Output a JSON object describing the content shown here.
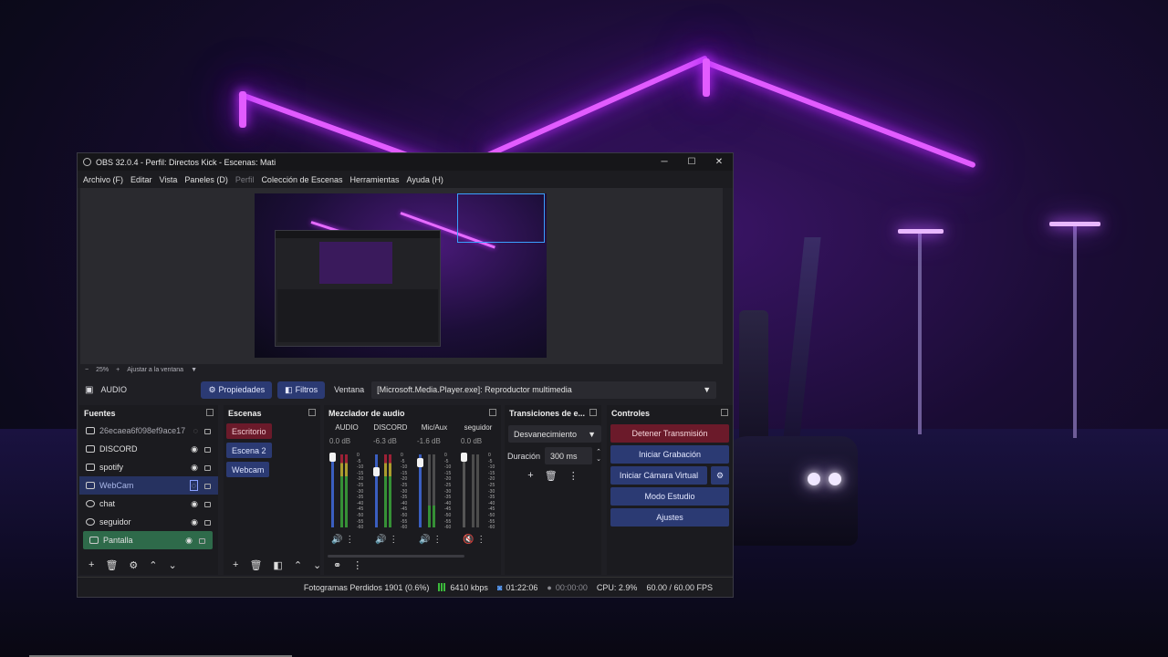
{
  "window": {
    "title": "OBS 32.0.4 - Perfil: Directos Kick - Escenas: Mati"
  },
  "menu": [
    "Archivo (F)",
    "Editar",
    "Vista",
    "Paneles (D)",
    "Perfil",
    "Colección de Escenas",
    "Herramientas",
    "Ayuda (H)"
  ],
  "zoom": {
    "level": "25%",
    "fit_label": "Ajustar a la ventana"
  },
  "source_bar": {
    "selected": "AUDIO",
    "properties": "Propiedades",
    "filters": "Filtros",
    "window_label": "Ventana",
    "window_value": "[Microsoft.Media.Player.exe]: Reproductor multimedia"
  },
  "sources": {
    "title": "Fuentes",
    "items": [
      {
        "name": "26ecaea6f098ef9ace17",
        "visible": false
      },
      {
        "name": "DISCORD",
        "visible": true
      },
      {
        "name": "spotify",
        "visible": true
      },
      {
        "name": "WebCam",
        "visible": false
      },
      {
        "name": "chat",
        "visible": true
      },
      {
        "name": "seguidor",
        "visible": true
      },
      {
        "name": "Pantalla",
        "visible": true
      }
    ]
  },
  "scenes": {
    "title": "Escenas",
    "items": [
      "Escritorio",
      "Escena 2",
      "Webcam"
    ]
  },
  "mixer": {
    "title": "Mezclador de audio",
    "channels": [
      {
        "name": "AUDIO",
        "db": "0.0 dB",
        "muted": false
      },
      {
        "name": "DISCORD",
        "db": "-6.3 dB",
        "muted": false
      },
      {
        "name": "Mic/Aux",
        "db": "-1.6 dB",
        "muted": false
      },
      {
        "name": "seguidor",
        "db": "0.0 dB",
        "muted": true
      }
    ],
    "ticks": [
      "0",
      "-5",
      "-10",
      "-15",
      "-20",
      "-25",
      "-30",
      "-35",
      "-40",
      "-45",
      "-50",
      "-55",
      "-60"
    ]
  },
  "transitions": {
    "title": "Transiciones de e...",
    "selected": "Desvanecimiento",
    "duration_label": "Duración",
    "duration_value": "300 ms"
  },
  "controls": {
    "title": "Controles",
    "stop_stream": "Detener Transmisión",
    "start_recording": "Iniciar Grabación",
    "start_virtualcam": "Iniciar Cámara Virtual",
    "studio_mode": "Modo Estudio",
    "settings": "Ajustes"
  },
  "status": {
    "dropped_frames": "Fotogramas Perdidos 1901 (0.6%)",
    "bitrate": "6410 kbps",
    "stream_time": "01:22:06",
    "rec_time": "00:00:00",
    "cpu": "CPU: 2.9%",
    "fps": "60.00 / 60.00 FPS"
  },
  "colors": {
    "accent_blue": "#2b3a73",
    "stop_red": "#6b1a2a",
    "selected_source": "#2e6a4a",
    "webcam_highlight": "#2a3a70"
  }
}
